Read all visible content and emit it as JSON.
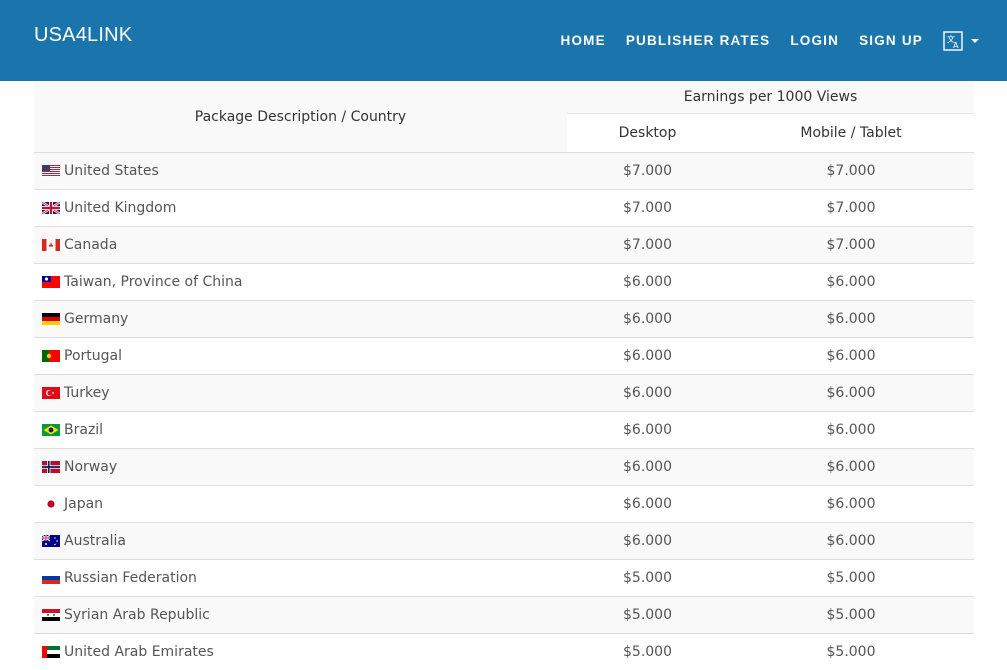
{
  "brand": "USA4LINK",
  "nav": {
    "home": "HOME",
    "publisher_rates": "PUBLISHER RATES",
    "login": "LOGIN",
    "signup": "SIGN UP",
    "language_icon": "translate-icon"
  },
  "table": {
    "col_desc": "Package Description / Country",
    "col_earnings": "Earnings per 1000 Views",
    "col_desktop": "Desktop",
    "col_mobile": "Mobile / Tablet",
    "rows": [
      {
        "flag": "us",
        "country": "United States",
        "desktop": "$7.000",
        "mobile": "$7.000"
      },
      {
        "flag": "gb",
        "country": "United Kingdom",
        "desktop": "$7.000",
        "mobile": "$7.000"
      },
      {
        "flag": "ca",
        "country": "Canada",
        "desktop": "$7.000",
        "mobile": "$7.000"
      },
      {
        "flag": "tw",
        "country": "Taiwan, Province of China",
        "desktop": "$6.000",
        "mobile": "$6.000"
      },
      {
        "flag": "de",
        "country": "Germany",
        "desktop": "$6.000",
        "mobile": "$6.000"
      },
      {
        "flag": "pt",
        "country": "Portugal",
        "desktop": "$6.000",
        "mobile": "$6.000"
      },
      {
        "flag": "tr",
        "country": "Turkey",
        "desktop": "$6.000",
        "mobile": "$6.000"
      },
      {
        "flag": "br",
        "country": "Brazil",
        "desktop": "$6.000",
        "mobile": "$6.000"
      },
      {
        "flag": "no",
        "country": "Norway",
        "desktop": "$6.000",
        "mobile": "$6.000"
      },
      {
        "flag": "jp",
        "country": "Japan",
        "desktop": "$6.000",
        "mobile": "$6.000"
      },
      {
        "flag": "au",
        "country": "Australia",
        "desktop": "$6.000",
        "mobile": "$6.000"
      },
      {
        "flag": "ru",
        "country": "Russian Federation",
        "desktop": "$5.000",
        "mobile": "$5.000"
      },
      {
        "flag": "sy",
        "country": "Syrian Arab Republic",
        "desktop": "$5.000",
        "mobile": "$5.000"
      },
      {
        "flag": "ae",
        "country": "United Arab Emirates",
        "desktop": "$5.000",
        "mobile": "$5.000"
      }
    ]
  }
}
